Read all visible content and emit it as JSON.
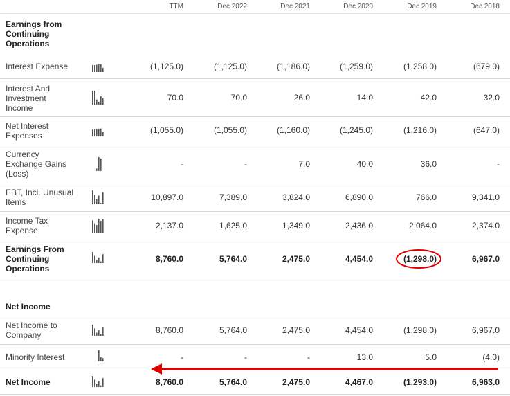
{
  "columns": [
    "TTM",
    "Dec 2022",
    "Dec 2021",
    "Dec 2020",
    "Dec 2019",
    "Dec 2018"
  ],
  "sections": {
    "earnings_title": "Earnings from Continuing Operations",
    "net_income_title": "Net Income"
  },
  "rows": {
    "interest_expense": {
      "label": "Interest Expense",
      "values": [
        "(1,125.0)",
        "(1,125.0)",
        "(1,186.0)",
        "(1,259.0)",
        "(1,258.0)",
        "(679.0)"
      ]
    },
    "interest_investment_income": {
      "label": "Interest And Investment Income",
      "values": [
        "70.0",
        "70.0",
        "26.0",
        "14.0",
        "42.0",
        "32.0"
      ]
    },
    "net_interest_expenses": {
      "label": "Net Interest Expenses",
      "values": [
        "(1,055.0)",
        "(1,055.0)",
        "(1,160.0)",
        "(1,245.0)",
        "(1,216.0)",
        "(647.0)"
      ]
    },
    "currency_exchange": {
      "label": "Currency Exchange Gains (Loss)",
      "values": [
        "-",
        "-",
        "7.0",
        "40.0",
        "36.0",
        "-"
      ]
    },
    "ebt_incl_unusual": {
      "label": "EBT, Incl. Unusual Items",
      "values": [
        "10,897.0",
        "7,389.0",
        "3,824.0",
        "6,890.0",
        "766.0",
        "9,341.0"
      ]
    },
    "income_tax": {
      "label": "Income Tax Expense",
      "values": [
        "2,137.0",
        "1,625.0",
        "1,349.0",
        "2,436.0",
        "2,064.0",
        "2,374.0"
      ]
    },
    "earnings_continuing": {
      "label": "Earnings From Continuing Operations",
      "values": [
        "8,760.0",
        "5,764.0",
        "2,475.0",
        "4,454.0",
        "(1,298.0)",
        "6,967.0"
      ]
    },
    "net_income_to_company": {
      "label": "Net Income to Company",
      "values": [
        "8,760.0",
        "5,764.0",
        "2,475.0",
        "4,454.0",
        "(1,298.0)",
        "6,967.0"
      ]
    },
    "minority_interest": {
      "label": "Minority Interest",
      "values": [
        "-",
        "-",
        "-",
        "13.0",
        "5.0",
        "(4.0)"
      ]
    },
    "net_income": {
      "label": "Net Income",
      "values": [
        "8,760.0",
        "5,764.0",
        "2,475.0",
        "4,467.0",
        "(1,293.0)",
        "6,963.0"
      ]
    }
  },
  "sparklines": {
    "interest_expense": [
      0.62,
      0.62,
      0.66,
      0.7,
      0.7,
      0.38
    ],
    "interest_investment_income": [
      1.0,
      1.0,
      0.37,
      0.2,
      0.6,
      0.46
    ],
    "net_interest_expenses": [
      0.62,
      0.62,
      0.66,
      0.7,
      0.7,
      0.38
    ],
    "currency_exchange": [
      0,
      0,
      0.18,
      1.0,
      0.9,
      0
    ],
    "ebt_incl_unusual": [
      1.0,
      0.68,
      0.35,
      0.63,
      0.07,
      0.86
    ],
    "income_tax": [
      0.88,
      0.67,
      0.55,
      1.0,
      0.85,
      0.97
    ],
    "earnings_continuing": [
      1.0,
      0.66,
      0.28,
      0.51,
      0.15,
      0.8
    ],
    "net_income_to_company": [
      1.0,
      0.66,
      0.28,
      0.51,
      0.15,
      0.8
    ],
    "minority_interest": [
      0,
      0,
      0,
      1.0,
      0.38,
      0.3
    ],
    "net_income": [
      1.0,
      0.66,
      0.28,
      0.51,
      0.15,
      0.8
    ]
  },
  "annotations": {
    "highlight_color": "#e00000",
    "circled_value": "(1,298.0)",
    "arrow": "points left along Minority Interest row"
  }
}
